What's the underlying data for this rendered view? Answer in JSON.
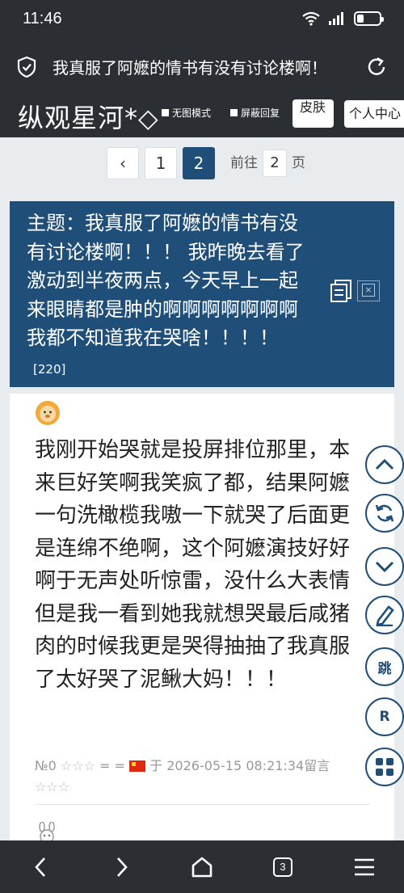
{
  "status": {
    "time": "11:46"
  },
  "urlbar": {
    "title": "我真服了阿嬷的情书有没有讨论楼啊！"
  },
  "site": {
    "brand": "纵观星河*◇",
    "option_noimage": "无图模式",
    "option_block": "屏蔽回复",
    "skin_label": "皮肤",
    "user_center_label": "个人中心"
  },
  "pager": {
    "prev": "‹",
    "pages": [
      "1",
      "2"
    ],
    "current": "2",
    "goto_prefix": "前往",
    "goto_value": "2",
    "goto_suffix": "页"
  },
  "topic": {
    "text": "主题：我真服了阿嬷的情书有没有讨论楼啊！！！ 我昨晚去看了激动到半夜两点，今天早上一起来眼睛都是肿的啊啊啊啊啊啊啊我都不知道我在哭啥！！！！",
    "count": "[220]"
  },
  "post": {
    "body": "我刚开始哭就是投屏排位那里，本来巨好笑啊我笑疯了都，结果阿嬷一句洗橄榄我嗷一下就哭了后面更是连绵不绝啊，这个阿嬷演技好好啊于无声处听惊雷，没什么大表情但是我一看到她我就想哭最后咸猪肉的时候我更是哭得抽抽了我真服了太好哭了泥鳅大妈！！！",
    "floor": "№0",
    "stars1": "☆☆☆",
    "equals": "= =",
    "at": "于",
    "timestamp": "2026-05-15 08:21:34",
    "reply": "留言",
    "stars2": "☆☆☆"
  },
  "fab": {
    "jump": "跳",
    "r": "R"
  },
  "nav": {
    "tab_count": "3"
  },
  "colors": {
    "topbar": "#2b2f34",
    "accent": "#1f4e79",
    "background": "#e9ecef"
  }
}
